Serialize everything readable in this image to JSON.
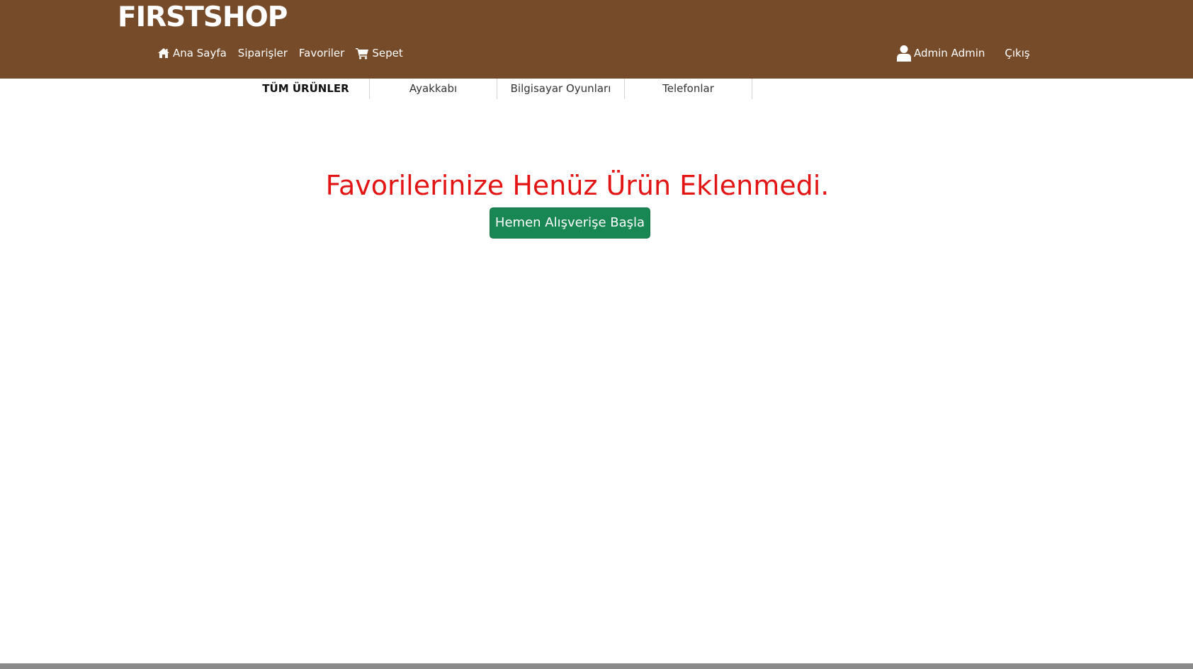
{
  "brand": {
    "name": "FIRSTSHOP"
  },
  "nav": {
    "home": "Ana Sayfa",
    "orders": "Siparişler",
    "favorites": "Favoriler",
    "cart": "Sepet",
    "user": "Admin Admin",
    "logout": "Çıkış"
  },
  "icons": {
    "home": "home-icon",
    "cart": "cart-icon",
    "user": "user-icon"
  },
  "categories": [
    {
      "label": "TÜM ÜRÜNLER",
      "active": true
    },
    {
      "label": "Ayakkabı",
      "active": false
    },
    {
      "label": "Bilgisayar Oyunları",
      "active": false
    },
    {
      "label": "Telefonlar",
      "active": false
    }
  ],
  "main": {
    "empty_message": "Favorilerinize Henüz Ürün Eklenmedi.",
    "start_button": "Hemen Alışverişe Başla"
  },
  "colors": {
    "header_bg": "#754b2a",
    "message": "#e31414",
    "button_bg": "#198754"
  }
}
